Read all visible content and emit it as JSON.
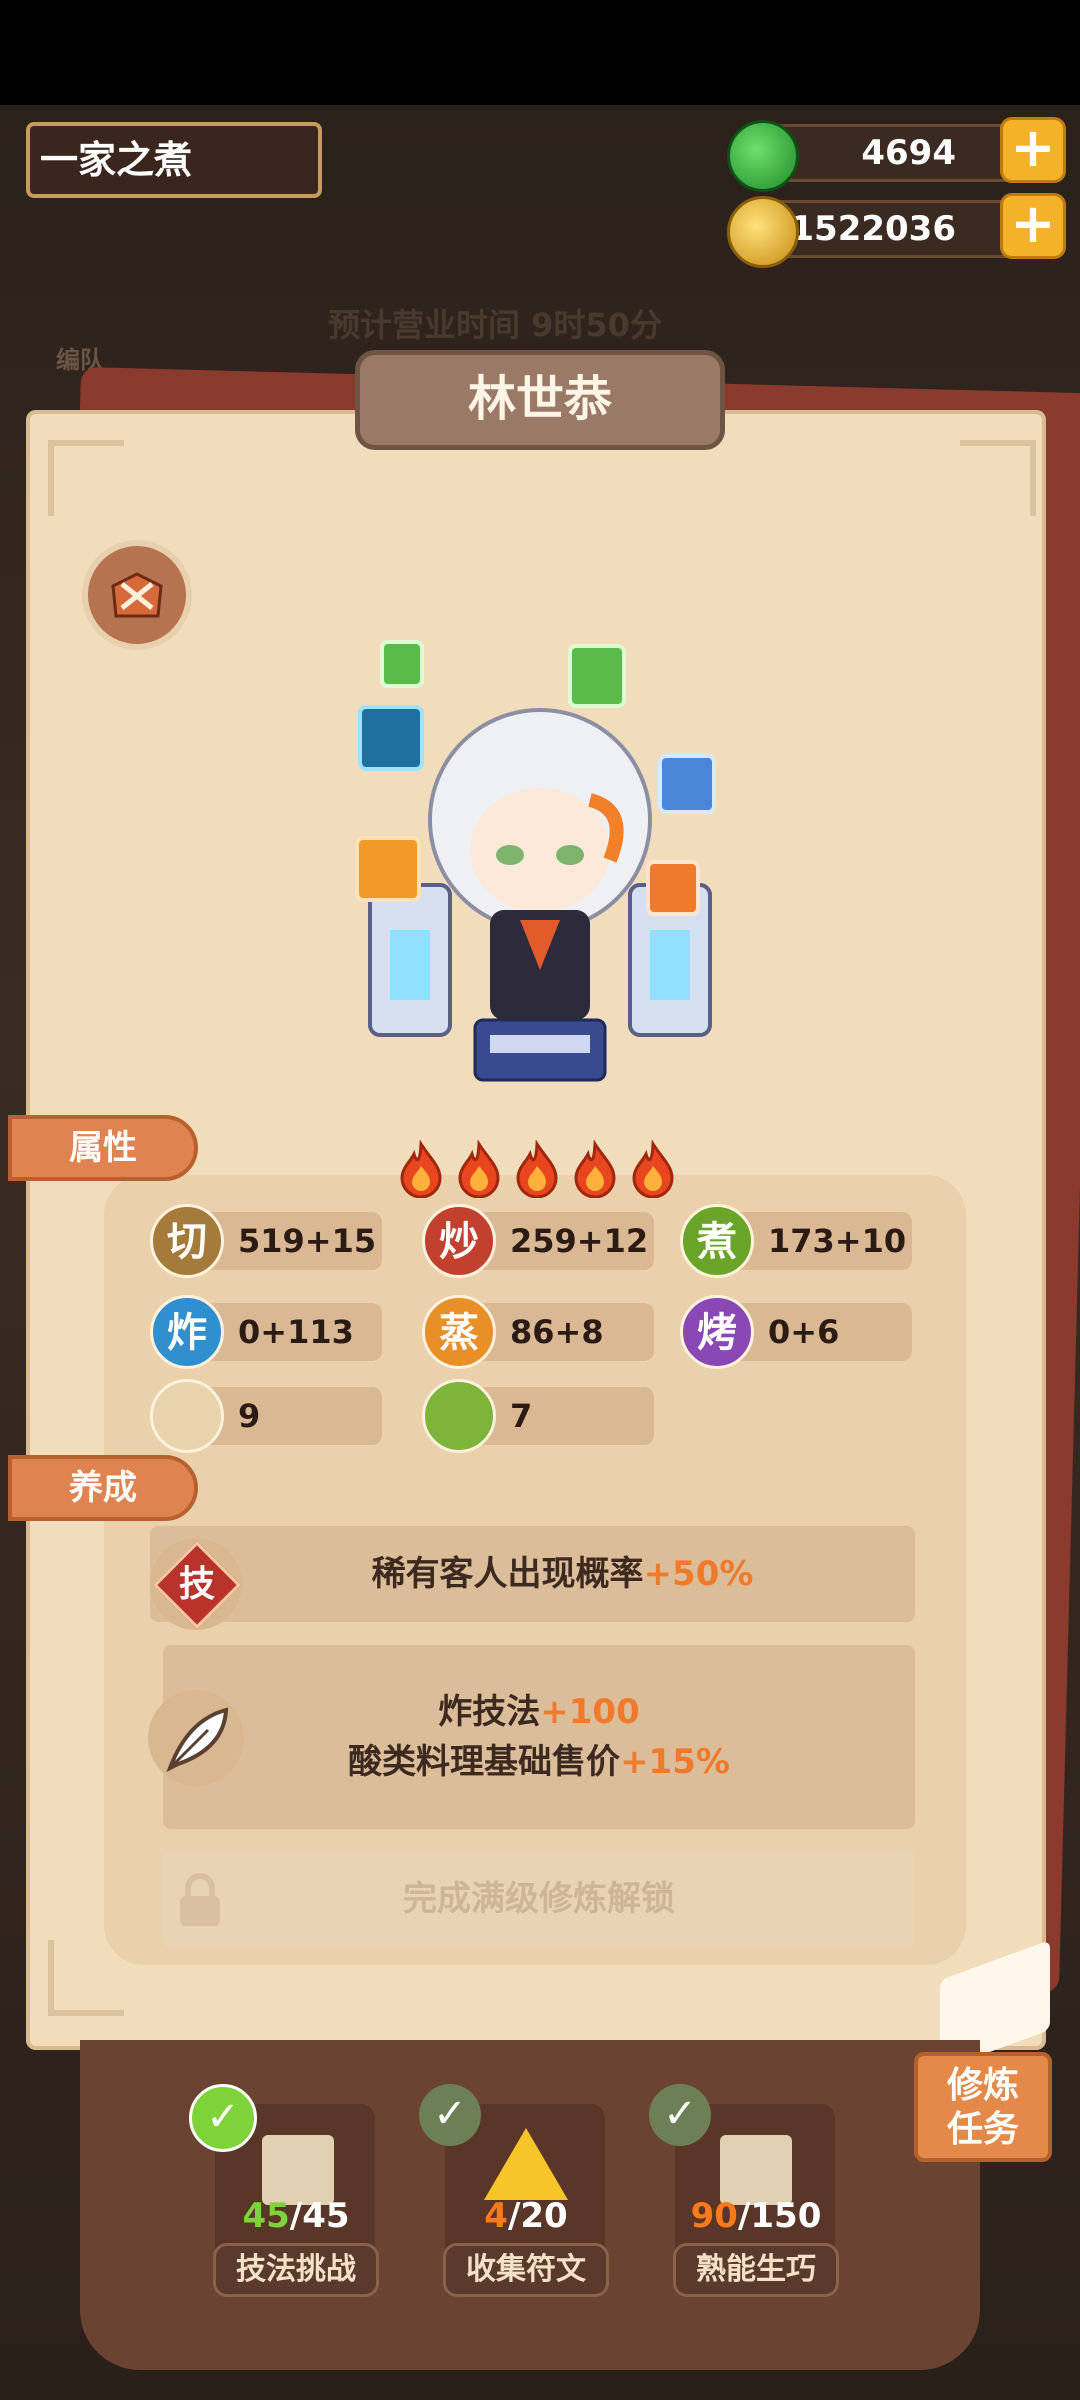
{
  "header": {
    "shop_name": "一家之煮",
    "jade_amount": "4694",
    "coin_amount": "1522036",
    "plus_label": "+"
  },
  "background": {
    "business_time": "预计营业时间   9时50分",
    "left_label": "编队"
  },
  "character": {
    "name": "林世恭",
    "stars": 5
  },
  "sections": {
    "attributes_tag": "属性",
    "cultivation_tag": "养成"
  },
  "stats": [
    {
      "icon": "切",
      "value": "519+15",
      "color": "#a47b3a"
    },
    {
      "icon": "炒",
      "value": "259+12",
      "color": "#c2402e"
    },
    {
      "icon": "煮",
      "value": "173+10",
      "color": "#6aa52a"
    },
    {
      "icon": "炸",
      "value": "0+113",
      "color": "#2f8fcf"
    },
    {
      "icon": "蒸",
      "value": "86+8",
      "color": "#e98f28"
    },
    {
      "icon": "烤",
      "value": "0+6",
      "color": "#8a48b5"
    },
    {
      "icon": "",
      "value": "9",
      "color": "#d8b98a"
    },
    {
      "icon": "",
      "value": "7",
      "color": "#7db43a"
    }
  ],
  "cultivation": {
    "skill_badge": "技",
    "skill_text": "稀有客人出现概率",
    "skill_bonus": "+50%",
    "line1_text": "炸技法",
    "line1_bonus": "+100",
    "line2_text": "酸类料理基础售价",
    "line2_bonus": "+15%",
    "locked_text": "完成满级修炼解锁"
  },
  "tasks": [
    {
      "done": "45",
      "total": "/45",
      "label": "技法挑战",
      "done_color": "#7fd33a"
    },
    {
      "done": "4",
      "total": "/20",
      "label": "收集符文",
      "done_color": "#ff7a1a"
    },
    {
      "done": "90",
      "total": "/150",
      "label": "熟能生巧",
      "done_color": "#ff7a1a"
    }
  ],
  "train_button": "修炼\n任务",
  "colors": {
    "panel": "#f1dcbc",
    "accent": "#f07a2c",
    "tag": "#df8350"
  }
}
